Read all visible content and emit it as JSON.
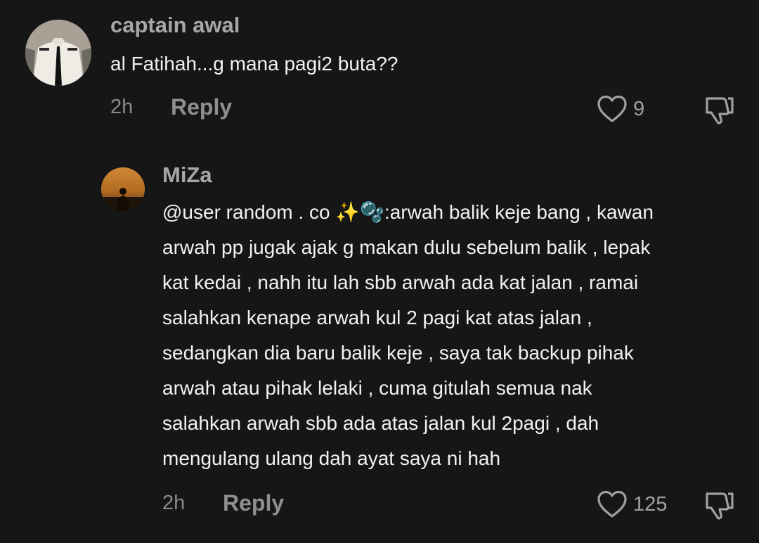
{
  "comments": [
    {
      "username": "captain awal",
      "text": "al Fatihah...g mana pagi2 buta??",
      "time": "2h",
      "reply_label": "Reply",
      "likes": "9",
      "avatar_icon": "pilot-uniform-avatar"
    },
    {
      "username": "MiZa",
      "lines": [
        "@user random . co ✨🫧:arwah balik keje bang , kawan",
        "arwah pp jugak ajak g makan dulu sebelum balik , lepak",
        "kat kedai , nahh itu lah sbb arwah ada kat jalan , ramai",
        "salahkan kenape arwah kul 2 pagi kat atas jalan ,",
        "sedangkan dia baru balik keje , saya tak backup pihak",
        "arwah atau pihak lelaki , cuma gitulah semua nak",
        "salahkan arwah sbb ada atas jalan kul 2pagi , dah",
        "mengulang ulang dah ayat saya ni hah"
      ],
      "time": "2h",
      "reply_label": "Reply",
      "likes": "125",
      "avatar_icon": "sunset-silhouette-avatar"
    }
  ],
  "colors": {
    "background": "#161616",
    "username": "#a7a7a7",
    "text": "#f2f2f2",
    "meta": "#8a8a8a"
  }
}
